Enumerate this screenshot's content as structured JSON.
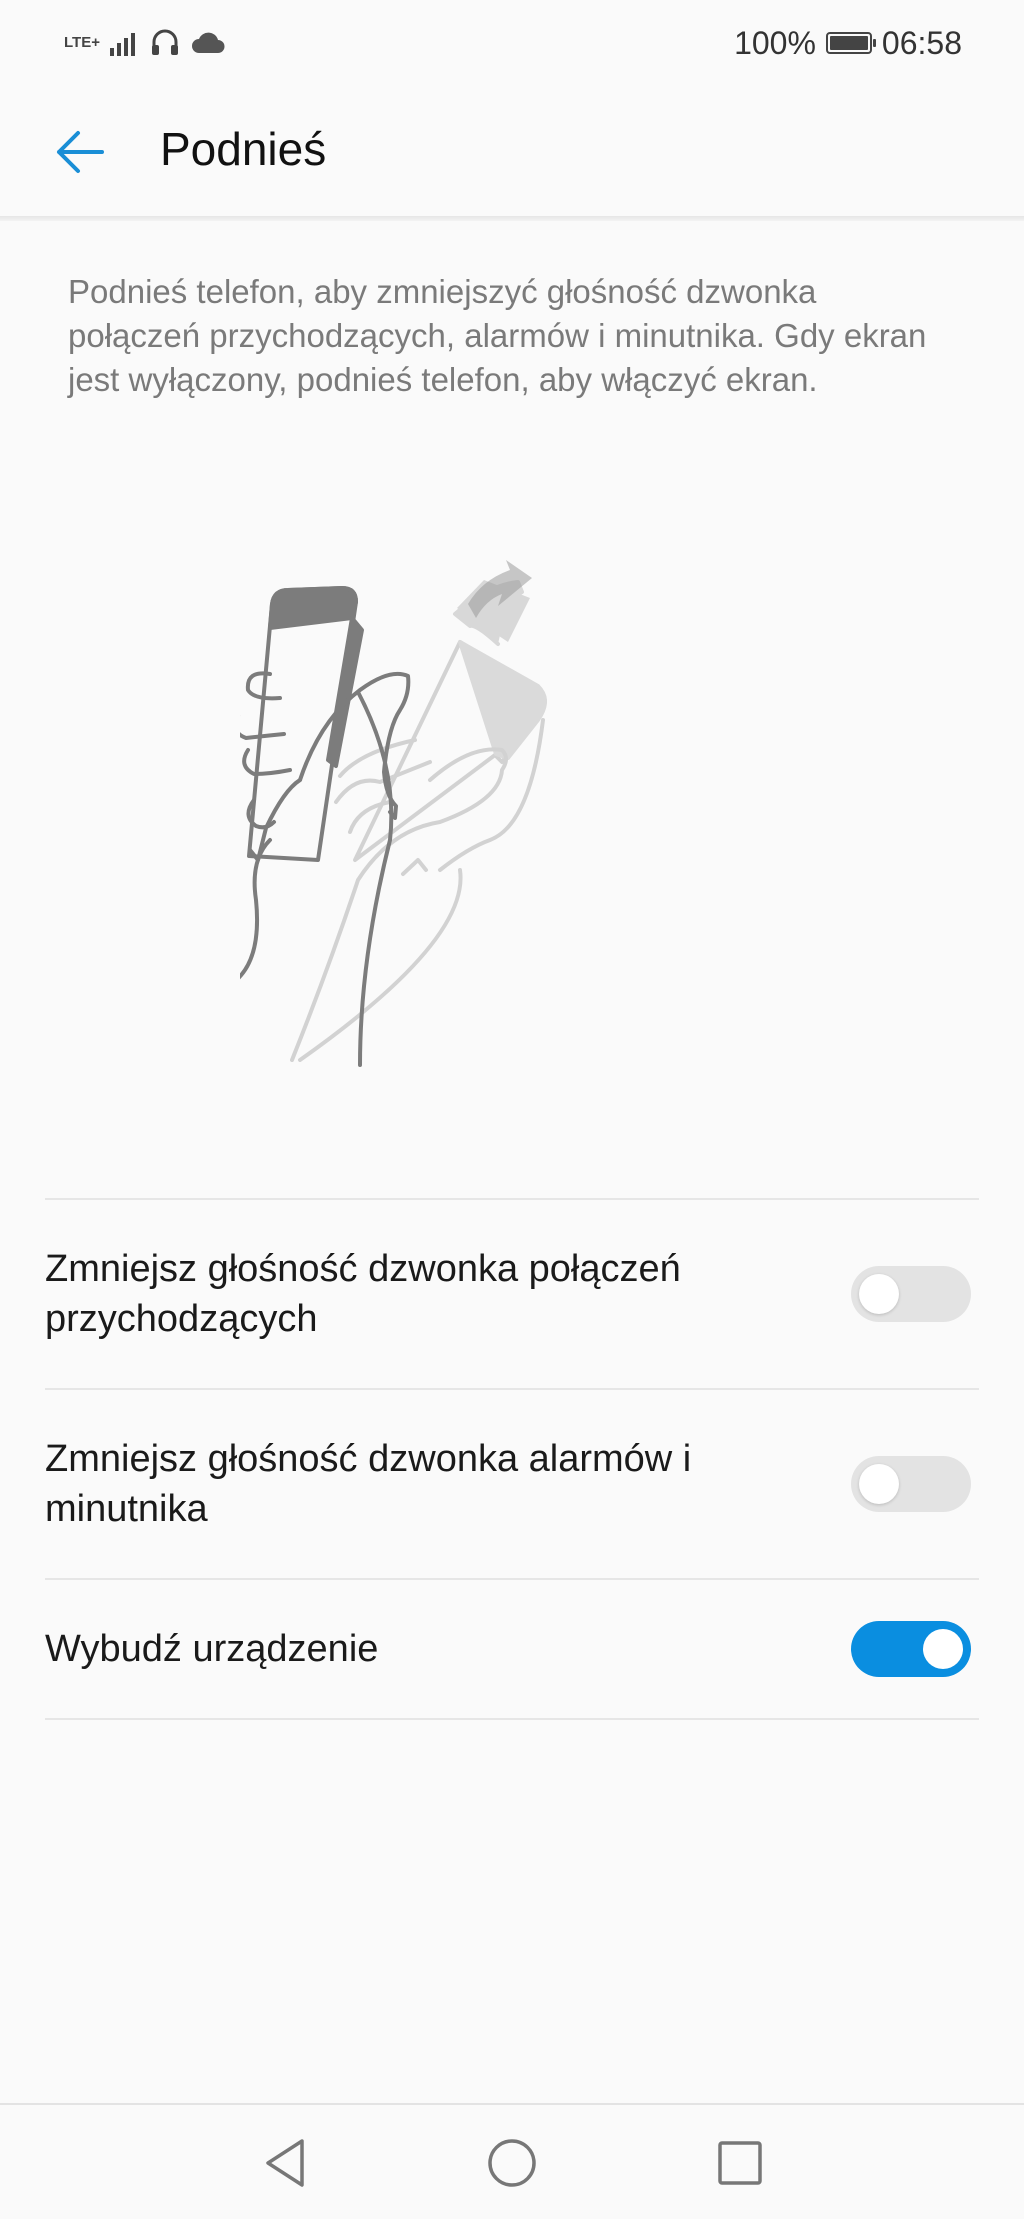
{
  "status_bar": {
    "network": "LTE+",
    "battery_percent": "100%",
    "time": "06:58",
    "icons": [
      "signal-icon",
      "headset-icon",
      "cloud-icon",
      "battery-icon"
    ]
  },
  "header": {
    "title": "Podnieś",
    "back_icon": "arrow-left-icon",
    "accent_color": "#1a8ed6"
  },
  "description": "Podnieś telefon, aby zmniejszyć głośność dzwonka połączeń przychodzących, alarmów i minutnika. Gdy ekran jest wyłączony, podnieś telefon, aby włączyć ekran.",
  "settings": [
    {
      "label": "Zmniejsz głośność dzwonka połączeń przychodzących",
      "enabled": false
    },
    {
      "label": "Zmniejsz głośność dzwonka alarmów i minutnika",
      "enabled": false
    },
    {
      "label": "Wybudź urządzenie",
      "enabled": true
    }
  ],
  "nav_bar": {
    "icons": [
      "back-triangle-icon",
      "home-circle-icon",
      "recents-square-icon"
    ]
  },
  "colors": {
    "toggle_on": "#0a8ee0",
    "toggle_off": "#e3e3e3"
  }
}
